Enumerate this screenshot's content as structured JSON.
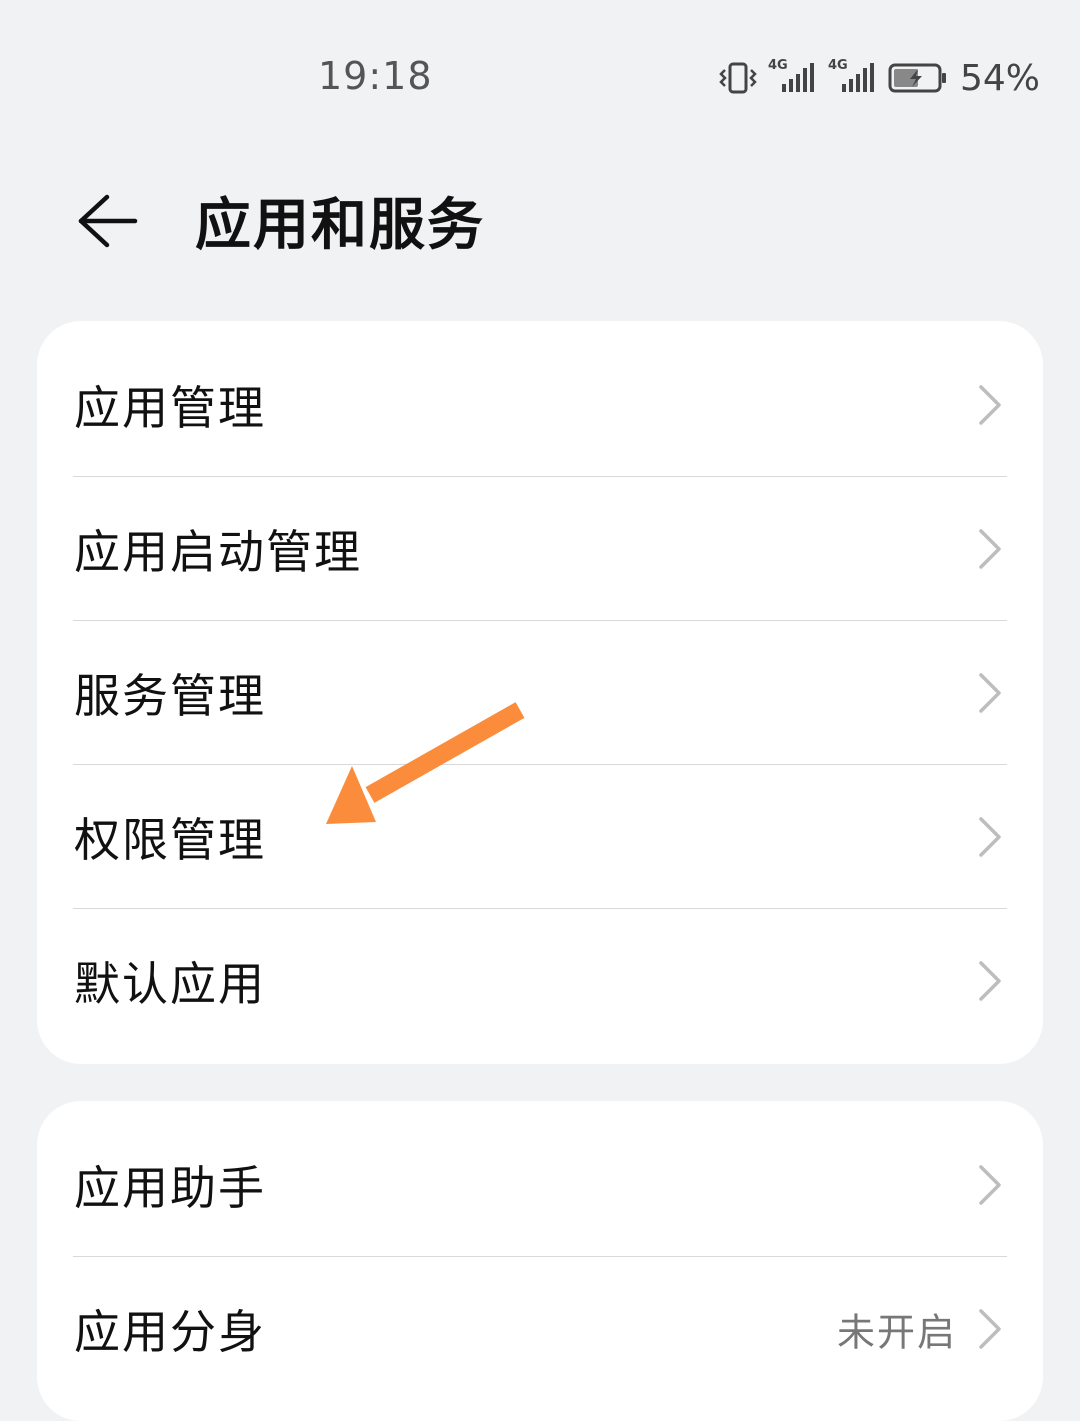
{
  "status_bar": {
    "time": "19:18",
    "battery_percent": "54%",
    "network_1": "4G",
    "network_2": "4G"
  },
  "header": {
    "title": "应用和服务"
  },
  "card1": {
    "items": [
      {
        "label": "应用管理"
      },
      {
        "label": "应用启动管理"
      },
      {
        "label": "服务管理"
      },
      {
        "label": "权限管理"
      },
      {
        "label": "默认应用"
      }
    ]
  },
  "card2": {
    "items": [
      {
        "label": "应用助手"
      },
      {
        "label": "应用分身",
        "value": "未开启"
      }
    ]
  },
  "colors": {
    "background": "#f1f2f4",
    "card": "#ffffff",
    "annotation_arrow": "#fb8c3c"
  },
  "icons": {
    "back": "arrow-left-icon",
    "chevron": "chevron-right-icon",
    "vibrate": "vibrate-icon",
    "signal": "signal-icon",
    "battery": "battery-charging-icon",
    "annotation": "annotation-arrow-icon"
  }
}
